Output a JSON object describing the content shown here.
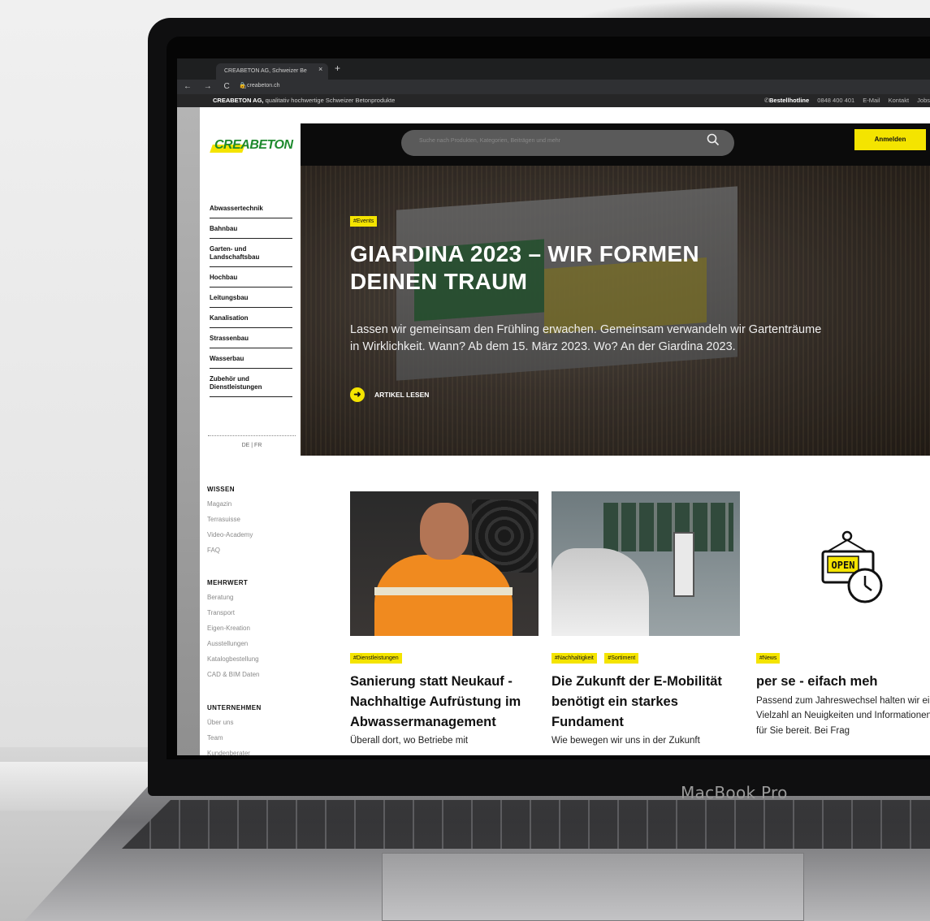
{
  "browser": {
    "tab_title": "CREABETON AG, Schweizer Be",
    "tab_close": "×",
    "new_tab": "+",
    "url": "creabeton.ch",
    "nav_icons": "← → C ⌂"
  },
  "site_bar": {
    "company": "CREABETON AG,",
    "tagline": "qualitativ hochwertige Schweizer Betonprodukte",
    "hotline_label": "Bestellhotline",
    "hotline_number": "0848 400 401",
    "links": [
      "E-Mail",
      "Kontakt",
      "Jobs"
    ]
  },
  "header": {
    "logo": "CREABETON",
    "search_placeholder": "Suche nach Produkten, Kategorien, Beiträgen und mehr",
    "login_label": "Anmelden"
  },
  "sidebar": {
    "categories": [
      "Abwassertechnik",
      "Bahnbau",
      "Garten- und Landschaftsbau",
      "Hochbau",
      "Leitungsbau",
      "Kanalisation",
      "Strassenbau",
      "Wasserbau",
      "Zubehör und Dienstleistungen"
    ],
    "languages": "DE | FR",
    "sections": [
      {
        "title": "WISSEN",
        "links": [
          "Magazin",
          "Terrasuisse",
          "Video-Academy",
          "FAQ"
        ]
      },
      {
        "title": "MEHRWERT",
        "links": [
          "Beratung",
          "Transport",
          "Eigen-Kreation",
          "Ausstellungen",
          "Katalogbestellung",
          "CAD & BIM Daten"
        ]
      },
      {
        "title": "UNTERNEHMEN",
        "links": [
          "Über uns",
          "Team",
          "Kundenberater"
        ]
      }
    ]
  },
  "hero": {
    "tag": "#Events",
    "title": "GIARDINA 2023 – WIR FORMEN DEINEN TRAUM",
    "text": "Lassen wir gemeinsam den Frühling erwachen. Gemeinsam verwandeln wir Gartenträume in Wirklichkeit. Wann? Ab dem 15. März 2023. Wo? An der Giardina 2023.",
    "cta": "ARTIKEL LESEN"
  },
  "cards": [
    {
      "tags": [
        "#Dienstleistungen"
      ],
      "title": "Sanierung statt Neukauf - Nachhaltige Aufrüstung im Abwassermanagement",
      "text": "Überall dort, wo Betriebe mit"
    },
    {
      "tags": [
        "#Nachhaltigkeit",
        "#Sortiment"
      ],
      "title": "Die Zukunft der E-Mobilität benötigt ein starkes Fundament",
      "text": "Wie bewegen wir uns in der Zukunft"
    },
    {
      "tags": [
        "#News"
      ],
      "title": "per se - eifach meh",
      "text": "Passend zum Jahreswechsel halten wir eine Vielzahl an Neuigkeiten und Informationen für Sie bereit. Bei Frag"
    }
  ],
  "device": {
    "label": "MacBook Pro"
  },
  "colors": {
    "accent": "#f4e400",
    "brand_green": "#1e8a2e",
    "nav_bg": "#0b0b0b"
  }
}
